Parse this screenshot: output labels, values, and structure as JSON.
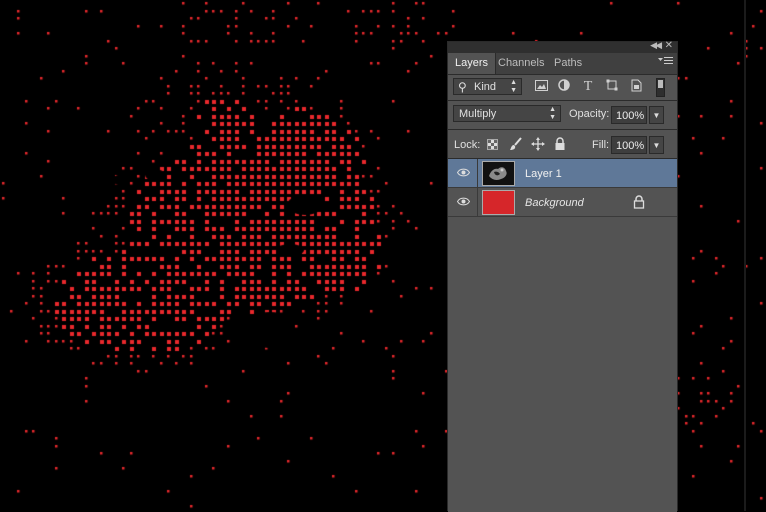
{
  "panel": {
    "tabs": [
      {
        "label": "Layers",
        "active": true
      },
      {
        "label": "Channels",
        "active": false
      },
      {
        "label": "Paths",
        "active": false
      }
    ],
    "filter": {
      "kind_label": "Kind",
      "icons": [
        "image-filter-icon",
        "adjustment-filter-icon",
        "type-filter-icon",
        "shape-filter-icon",
        "smart-object-filter-icon"
      ]
    },
    "blend": {
      "mode": "Multiply",
      "opacity_label": "Opacity:",
      "opacity_value": "100%"
    },
    "lock_row": {
      "lock_label": "Lock:",
      "fill_label": "Fill:",
      "fill_value": "100%"
    },
    "layers": [
      {
        "name": "Layer 1",
        "selected": true,
        "visible": true,
        "locked": false
      },
      {
        "name": "Background",
        "selected": false,
        "visible": true,
        "locked": true
      }
    ]
  },
  "colors": {
    "dots": "#e8282c",
    "background_layer_fill": "#d6262a",
    "selected_layer": "#5f7898",
    "panel_bg": "#535353"
  }
}
